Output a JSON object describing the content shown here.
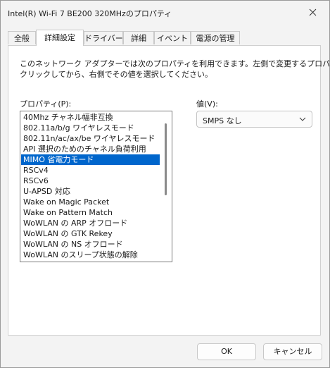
{
  "window": {
    "title": "Intel(R) Wi-Fi 7 BE200 320MHzのプロパティ"
  },
  "tabs": [
    {
      "label": "全般"
    },
    {
      "label": "詳細設定"
    },
    {
      "label": "ドライバー"
    },
    {
      "label": "詳細"
    },
    {
      "label": "イベント"
    },
    {
      "label": "電源の管理"
    }
  ],
  "active_tab": "詳細設定",
  "description": {
    "line1": "このネットワーク アダプターでは次のプロパティを利用できます。左側で変更するプロパティを",
    "line2": "クリックしてから、右側でその値を選択してください。"
  },
  "property_label": "プロパティ(P):",
  "value_label": "値(V):",
  "properties": [
    {
      "label": "40Mhz チャネル幅非互換"
    },
    {
      "label": "802.11a/b/g ワイヤレスモード"
    },
    {
      "label": "802.11n/ac/ax/be ワイヤレスモード"
    },
    {
      "label": "API 選択のためのチャネル負荷利用"
    },
    {
      "label": "MIMO 省電力モード"
    },
    {
      "label": "RSCv4"
    },
    {
      "label": "RSCv6"
    },
    {
      "label": "U-APSD 対応"
    },
    {
      "label": "Wake on Magic Packet"
    },
    {
      "label": "Wake on Pattern Match"
    },
    {
      "label": "WoWLAN の ARP オフロード"
    },
    {
      "label": "WoWLAN の GTK Rekey"
    },
    {
      "label": "WoWLAN の NS オフロード"
    },
    {
      "label": "WoWLAN のスリープ状態の解除"
    }
  ],
  "selected_property": "MIMO 省電力モード",
  "value_select": {
    "selected": "SMPS なし"
  },
  "buttons": {
    "ok": "OK",
    "cancel": "キャンセル"
  },
  "colors": {
    "selection": "#0066cc",
    "window_bg": "#f3f3f3",
    "panel_bg": "#ffffff"
  },
  "icons": {
    "close": "close-icon",
    "dropdown": "chevron-down-icon"
  }
}
